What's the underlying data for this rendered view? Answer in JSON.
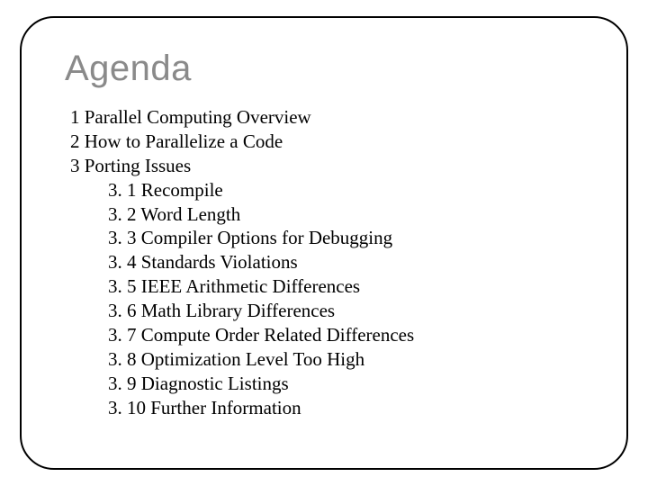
{
  "title": "Agenda",
  "items": [
    {
      "level": 1,
      "text": "1 Parallel Computing Overview"
    },
    {
      "level": 1,
      "text": "2 How to Parallelize a Code"
    },
    {
      "level": 1,
      "text": "3 Porting Issues"
    },
    {
      "level": 2,
      "text": "3. 1 Recompile"
    },
    {
      "level": 2,
      "text": "3. 2 Word Length"
    },
    {
      "level": 2,
      "text": "3. 3 Compiler Options for Debugging"
    },
    {
      "level": 2,
      "text": "3. 4 Standards Violations"
    },
    {
      "level": 2,
      "text": "3. 5 IEEE Arithmetic Differences"
    },
    {
      "level": 2,
      "text": "3. 6 Math Library Differences"
    },
    {
      "level": 2,
      "text": "3. 7 Compute Order Related Differences"
    },
    {
      "level": 2,
      "text": "3. 8 Optimization Level Too High"
    },
    {
      "level": 2,
      "text": "3. 9 Diagnostic Listings"
    },
    {
      "level": 2,
      "text": "3. 10 Further Information"
    }
  ]
}
